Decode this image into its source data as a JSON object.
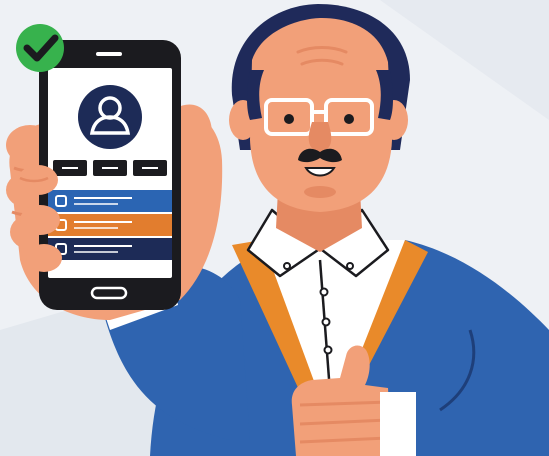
{
  "colors": {
    "background": "#eef1f5",
    "skin": "#f2a079",
    "skin_shadow": "#e58a63",
    "hair": "#1f2a5a",
    "sweater": "#2f64b0",
    "sweater_dark": "#1e3f7a",
    "stripe": "#e98a2a",
    "shirt": "#ffffff",
    "phone": "#1b1b1f",
    "check_badge": "#37b24d",
    "row_blue": "#2b65b3",
    "row_orange": "#e27d2e",
    "row_navy": "#1d2b57"
  },
  "phone": {
    "avatar_icon": "user-icon",
    "tab_count": 3,
    "list_rows": [
      {
        "color": "blue"
      },
      {
        "color": "orange"
      },
      {
        "color": "navy"
      }
    ]
  },
  "badge_icon": "check-icon",
  "thumbs_up_icon": "thumbs-up-icon"
}
